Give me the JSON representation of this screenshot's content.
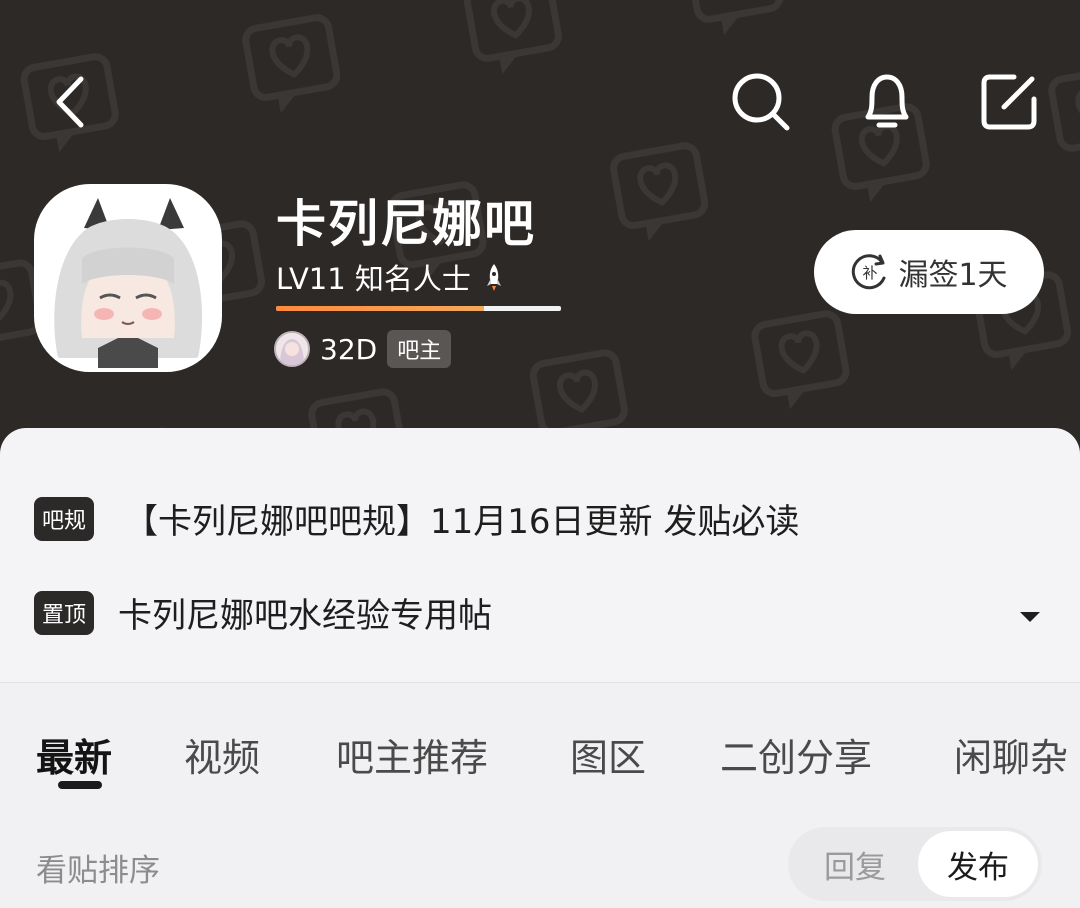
{
  "header": {
    "forum_name": "卡列尼娜吧",
    "level": "LV11 知名人士",
    "level_progress": 0.73,
    "owner_name": "32D",
    "owner_badge": "吧主",
    "sign_button": "漏签1天",
    "sign_icon_text": "补"
  },
  "notices": [
    {
      "badge": "吧规",
      "text": "【卡列尼娜吧吧规】11月16日更新 发贴必读"
    },
    {
      "badge": "置顶",
      "text": "卡列尼娜吧水经验专用帖"
    }
  ],
  "tabs": [
    {
      "label": "最新",
      "active": true
    },
    {
      "label": "视频"
    },
    {
      "label": "吧主推荐"
    },
    {
      "label": "图区"
    },
    {
      "label": "二创分享"
    },
    {
      "label": "闲聊杂"
    }
  ],
  "sort": {
    "label": "看贴排序",
    "options": [
      "回复",
      "发布"
    ],
    "selected": "发布"
  },
  "colors": {
    "header_bg": "#2c2927",
    "progress": "#ff8a3d",
    "panel_bg": "#f4f4f7"
  },
  "icons": [
    "back-icon",
    "search-icon",
    "bell-icon",
    "share-icon",
    "rocket-icon",
    "caret-down-icon"
  ]
}
